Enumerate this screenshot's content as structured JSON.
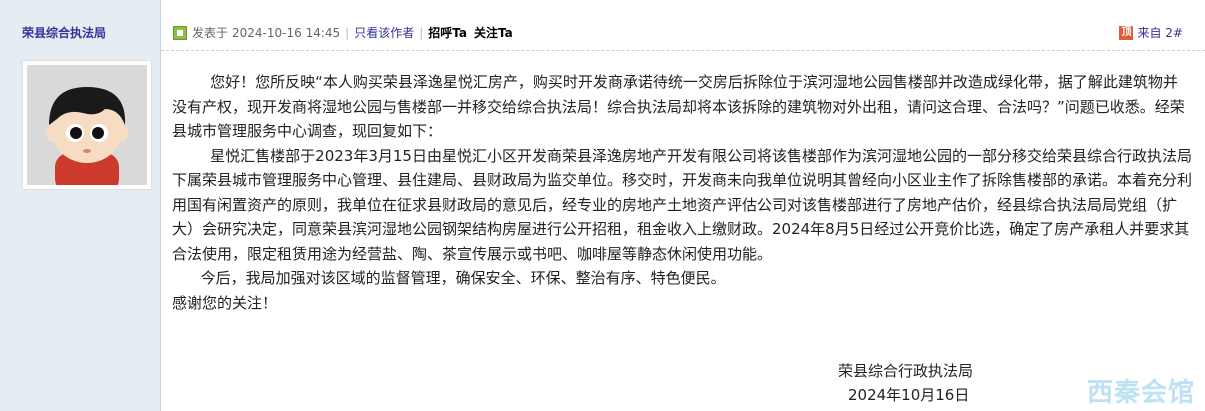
{
  "author": {
    "name": "荣县综合执法局"
  },
  "post_meta": {
    "posted_prefix": "发表于",
    "timestamp": "2024-10-16 14:45",
    "view_author_only": "只看该作者",
    "greet": "招呼Ta",
    "follow": "关注Ta"
  },
  "floor": {
    "label": "来自 2#"
  },
  "content": {
    "paragraphs": [
      "        您好！您所反映“本人购买荣县泽逸星悦汇房产，购买时开发商承诺待统一交房后拆除位于滨河湿地公园售楼部并改造成绿化带，据了解此建筑物并没有产权，现开发商将湿地公园与售楼部一并移交给综合执法局！综合执法局却将本该拆除的建筑物对外出租，请问这合理、合法吗？”问题已收悉。经荣县城市管理服务中心调查，现回复如下：",
      "        星悦汇售楼部于2023年3月15日由星悦汇小区开发商荣县泽逸房地产开发有限公司将该售楼部作为滨河湿地公园的一部分移交给荣县综合行政执法局下属荣县城市管理服务中心管理、县住建局、县财政局为监交单位。移交时，开发商未向我单位说明其曾经向小区业主作了拆除售楼部的承诺。本着充分利用国有闲置资产的原则，我单位在征求县财政局的意见后，经专业的房地产土地资产评估公司对该售楼部进行了房地产估价，经县综合执法局局党组（扩大）会研究决定，同意荣县滨河湿地公园钢架结构房屋进行公开招租，租金收入上缴财政。2024年8月5日经过公开竞价比选，确定了房产承租人并要求其合法使用，限定租赁用途为经营盐、陶、茶宣传展示或书吧、咖啡屋等静态休闲使用功能。",
      "      今后，我局加强对该区域的监督管理，确保安全、环保、整治有序、特色便民。",
      "感谢您的关注！"
    ]
  },
  "signature": {
    "org": "荣县综合行政执法局",
    "date": "2024年10月16日"
  },
  "watermark": {
    "text": "西秦会馆"
  },
  "colors": {
    "sidebar_bg": "#e5edf2",
    "link": "#333399",
    "watermark": "#bfe1f4"
  }
}
